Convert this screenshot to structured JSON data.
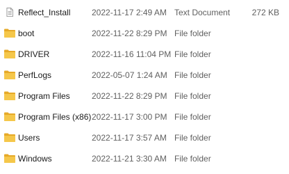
{
  "files": [
    {
      "name": "Reflect_Install",
      "date": "2022-11-17 2:49 AM",
      "type": "Text Document",
      "size": "272 KB",
      "icon": "text-document-icon"
    },
    {
      "name": "boot",
      "date": "2022-11-22 8:29 PM",
      "type": "File folder",
      "size": "",
      "icon": "folder-icon"
    },
    {
      "name": "DRIVER",
      "date": "2022-11-16 11:04 PM",
      "type": "File folder",
      "size": "",
      "icon": "folder-icon"
    },
    {
      "name": "PerfLogs",
      "date": "2022-05-07 1:24 AM",
      "type": "File folder",
      "size": "",
      "icon": "folder-icon"
    },
    {
      "name": "Program Files",
      "date": "2022-11-22 8:29 PM",
      "type": "File folder",
      "size": "",
      "icon": "folder-icon"
    },
    {
      "name": "Program Files (x86)",
      "date": "2022-11-17 3:00 PM",
      "type": "File folder",
      "size": "",
      "icon": "folder-icon"
    },
    {
      "name": "Users",
      "date": "2022-11-17 3:57 AM",
      "type": "File folder",
      "size": "",
      "icon": "folder-icon"
    },
    {
      "name": "Windows",
      "date": "2022-11-21 3:30 AM",
      "type": "File folder",
      "size": "",
      "icon": "folder-icon"
    }
  ],
  "colors": {
    "folder": "#f5c74a",
    "folder_dark": "#e6a928",
    "document": "#8a8a8a"
  }
}
